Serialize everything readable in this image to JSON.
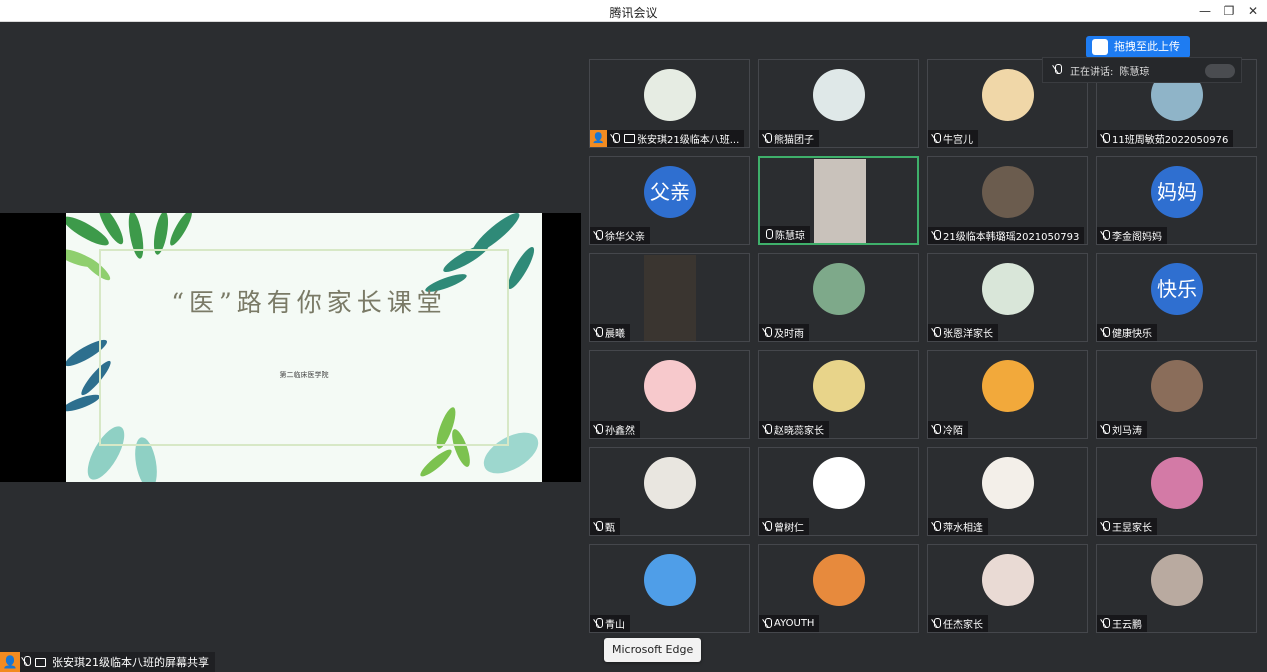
{
  "window": {
    "title": "腾讯会议"
  },
  "slide": {
    "title": "“医”路有你家长课堂",
    "subtitle": "第二临床医学院"
  },
  "share_label": "张安琪21级临本八班的屏幕共享",
  "speaking": {
    "label": "正在讲话:",
    "name": "陈慧琼"
  },
  "upload_button": "拖拽至此上传",
  "tooltip": "Microsoft Edge",
  "participants": [
    {
      "name": "张安琪21级临本八班...",
      "kind": "photo",
      "color": "#e6ece3",
      "host": true,
      "sharing": true
    },
    {
      "name": "熊猫团子",
      "kind": "photo",
      "color": "#dfe8e8"
    },
    {
      "name": "牛宫儿",
      "kind": "photo",
      "color": "#f0d7a8"
    },
    {
      "name": "11班周敏茹2022050976",
      "kind": "photo",
      "color": "#8fb4c8"
    },
    {
      "name": "徐华父亲",
      "kind": "text",
      "avatar_text": "父亲"
    },
    {
      "name": "陈慧琼",
      "kind": "video",
      "color": "#c9c2bb",
      "active": true,
      "mic_on": true
    },
    {
      "name": "21级临本韩璐瑶2021050793",
      "kind": "photo",
      "color": "#6b5c4e"
    },
    {
      "name": "李金阁妈妈",
      "kind": "text",
      "avatar_text": "妈妈"
    },
    {
      "name": "晨曦",
      "kind": "video",
      "color": "#3a3530"
    },
    {
      "name": "及时雨",
      "kind": "photo",
      "color": "#7ea98a"
    },
    {
      "name": "张恩洋家长",
      "kind": "photo",
      "color": "#d9e6d9"
    },
    {
      "name": "健康快乐",
      "kind": "text",
      "avatar_text": "快乐"
    },
    {
      "name": "孙鑫然",
      "kind": "photo",
      "color": "#f7c9cc"
    },
    {
      "name": "赵晓蕊家长",
      "kind": "photo",
      "color": "#e8d48a"
    },
    {
      "name": "冷陌",
      "kind": "photo",
      "color": "#f2a93b"
    },
    {
      "name": "刘马涛",
      "kind": "photo",
      "color": "#8a6d5a"
    },
    {
      "name": "甄",
      "kind": "photo",
      "color": "#e9e6e0"
    },
    {
      "name": "曾树仁",
      "kind": "photo",
      "color": "#ffffff"
    },
    {
      "name": "萍水相逢",
      "kind": "photo",
      "color": "#f3efe9"
    },
    {
      "name": "王昱家长",
      "kind": "photo",
      "color": "#d37aa6"
    },
    {
      "name": "青山",
      "kind": "photo",
      "color": "#4f9ee8"
    },
    {
      "name": "AYOUTH",
      "kind": "photo",
      "color": "#e78a3d"
    },
    {
      "name": "任杰家长",
      "kind": "photo",
      "color": "#e9dad4"
    },
    {
      "name": "王云鹏",
      "kind": "photo",
      "color": "#b9aaa0"
    }
  ]
}
